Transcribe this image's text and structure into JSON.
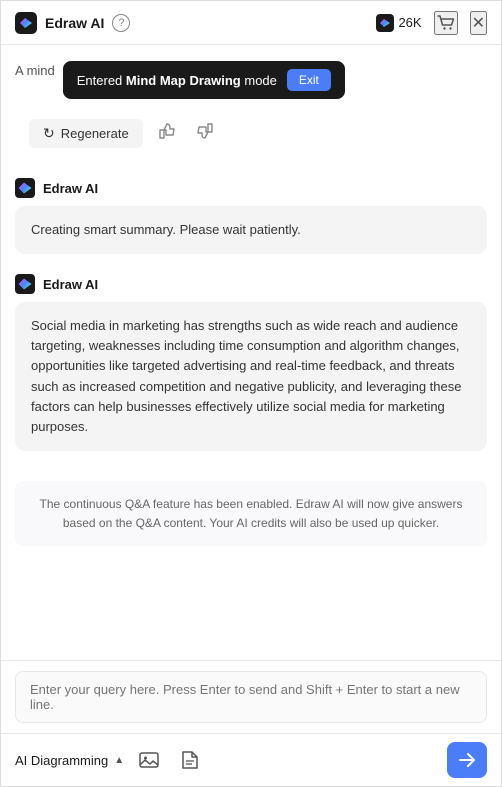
{
  "header": {
    "app_name": "Edraw AI",
    "help_label": "?",
    "credits_count": "26K",
    "close_label": "✕"
  },
  "toast": {
    "prefix": "A mind",
    "message_before_bold": "Entered ",
    "message_bold": "Mind Map Drawing",
    "message_after": " mode",
    "exit_label": "Exit"
  },
  "regenerate_bar": {
    "button_label": "Regenerate",
    "thumbs_up": "👍",
    "thumbs_down": "👎"
  },
  "messages": [
    {
      "sender": "Edraw AI",
      "content": "Creating smart summary. Please wait patiently."
    },
    {
      "sender": "Edraw AI",
      "content": "Social media in marketing has strengths such as wide reach and audience targeting, weaknesses including time consumption and algorithm changes, opportunities like targeted advertising and real-time feedback, and threats such as increased competition and negative publicity, and leveraging these factors can help businesses effectively utilize social media for marketing purposes."
    }
  ],
  "info_note": "The continuous Q&A feature has been enabled. Edraw AI will now give answers based on the Q&A content. Your AI credits will also be used up quicker.",
  "input": {
    "placeholder": "Enter your query here. Press Enter to send and Shift + Enter to start a new line."
  },
  "toolbar": {
    "ai_diagramming_label": "AI Diagramming",
    "dropdown_arrow": "▲",
    "send_icon": "➤"
  }
}
